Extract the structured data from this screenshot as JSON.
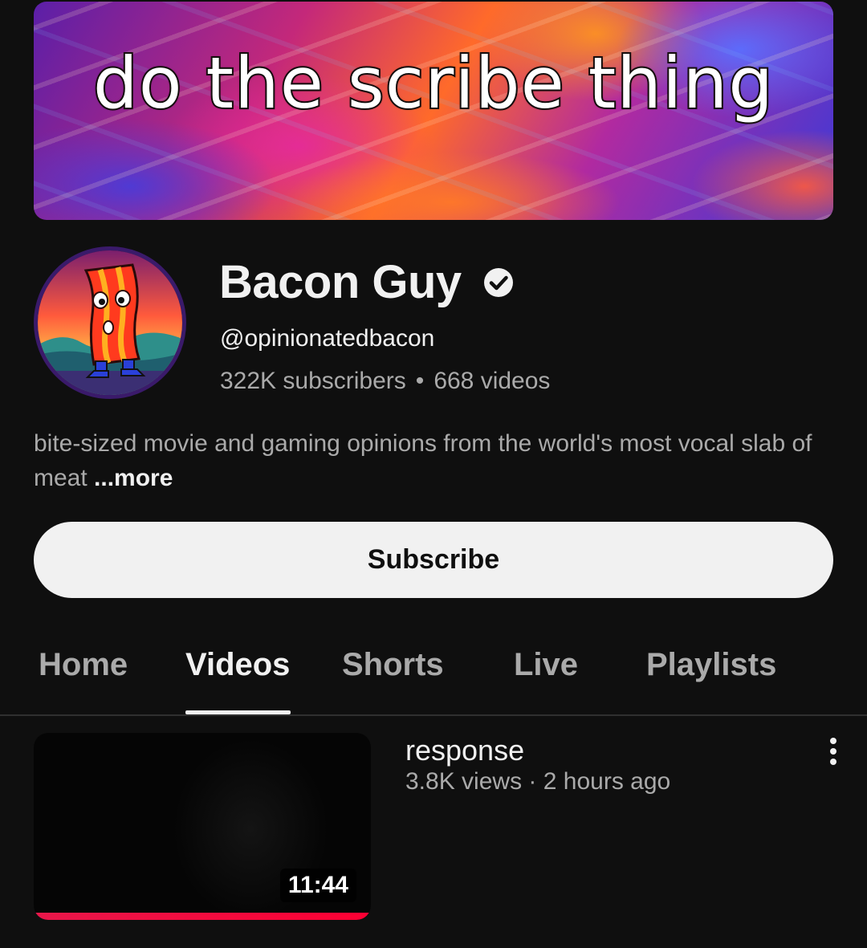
{
  "banner": {
    "text": "do the scribe thing"
  },
  "channel": {
    "name": "Bacon Guy",
    "verified": true,
    "handle": "@opinionatedbacon",
    "subscribers": "322K subscribers",
    "separator": "•",
    "videos": "668 videos",
    "description": "bite-sized movie and gaming opinions from the world's most vocal slab of meat",
    "more_label": "...more",
    "avatar_icon": "bacon-character-avatar"
  },
  "subscribe": {
    "label": "Subscribe"
  },
  "tabs": [
    {
      "label": "Home",
      "active": false
    },
    {
      "label": "Videos",
      "active": true
    },
    {
      "label": "Shorts",
      "active": false
    },
    {
      "label": "Live",
      "active": false
    },
    {
      "label": "Playlists",
      "active": false
    }
  ],
  "videos": [
    {
      "title": "response",
      "views": "3.8K views",
      "meta_separator": "·",
      "age": "2 hours ago",
      "duration": "11:44",
      "watched_progress": 1.0
    }
  ],
  "colors": {
    "background": "#0f0f0f",
    "text_primary": "#f1f1f1",
    "text_secondary": "#aaaaaa",
    "subscribe_bg": "#f1f1f1",
    "progress": "#ff0033"
  }
}
